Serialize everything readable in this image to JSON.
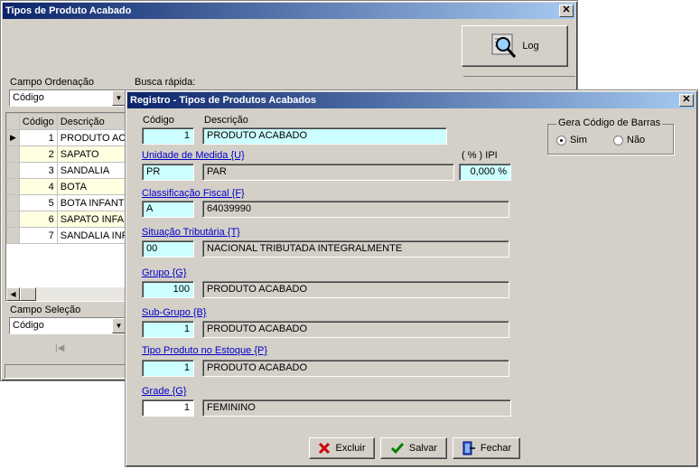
{
  "back_window": {
    "title": "Tipos de Produto Acabado",
    "close": "✕",
    "log_button": "Log",
    "campo_ordenacao_label": "Campo Ordenação",
    "campo_ordenacao_value": "Código",
    "busca_rapida_label": "Busca rápida:",
    "grid_headers": [
      "Código",
      "Descrição"
    ],
    "grid_rows": [
      {
        "codigo": "1",
        "descricao": "PRODUTO ACABADO"
      },
      {
        "codigo": "2",
        "descricao": "SAPATO"
      },
      {
        "codigo": "3",
        "descricao": "SANDALIA"
      },
      {
        "codigo": "4",
        "descricao": "BOTA"
      },
      {
        "codigo": "5",
        "descricao": "BOTA INFANTIL"
      },
      {
        "codigo": "6",
        "descricao": "SAPATO INFANTIL"
      },
      {
        "codigo": "7",
        "descricao": "SANDALIA INFANTIL"
      }
    ],
    "campo_selecao_label": "Campo Seleção",
    "campo_selecao_value": "Código"
  },
  "dialog": {
    "title": "Registro - Tipos de Produtos Acabados",
    "close": "✕",
    "codigo_label": "Código",
    "codigo_value": "1",
    "descricao_label": "Descrição",
    "descricao_value": "PRODUTO ACABADO",
    "unidade_label": "Unidade de Medida {U}",
    "unidade_code": "PR",
    "unidade_desc": "PAR",
    "ipi_label": "( % ) IPI",
    "ipi_value": "0,000 %",
    "classificacao_label": "Classificação Fiscal {F}",
    "classificacao_code": "A",
    "classificacao_desc": "64039990",
    "situacao_label": "Situação Tributária {T}",
    "situacao_code": "00",
    "situacao_desc": "NACIONAL TRIBUTADA INTEGRALMENTE",
    "grupo_label": "Grupo {G}",
    "grupo_code": "100",
    "grupo_desc": "PRODUTO ACABADO",
    "subgrupo_label": "Sub-Grupo {B}",
    "subgrupo_code": "1",
    "subgrupo_desc": "PRODUTO ACABADO",
    "tipo_estoque_label": "Tipo Produto no Estoque {P}",
    "tipo_estoque_code": "1",
    "tipo_estoque_desc": "PRODUTO ACABADO",
    "grade_label": "Grade {G}",
    "grade_code": "1",
    "grade_desc": "FEMININO",
    "barras_group_label": "Gera Código de Barras",
    "barras_sim": "Sim",
    "barras_nao": "Não",
    "barras_selected": "Sim",
    "excluir_button": "Excluir",
    "salvar_button": "Salvar",
    "fechar_button": "Fechar"
  },
  "colors": {
    "title_start": "#0a246a",
    "title_end": "#a6caf0",
    "field_highlight": "#ccffff",
    "window_face": "#d4d0c8",
    "link": "#0000cc"
  }
}
